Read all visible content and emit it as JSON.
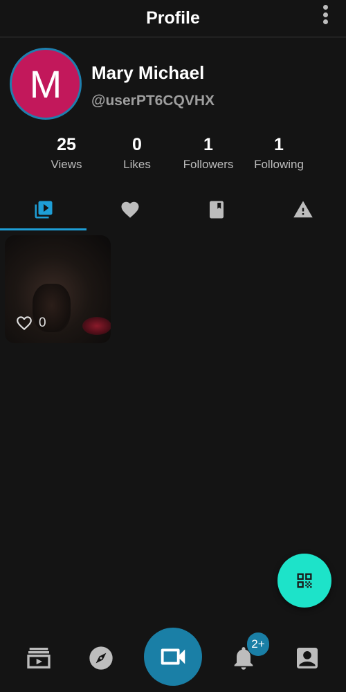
{
  "app_bar": {
    "title": "Profile",
    "more_icon": "more-vert-icon"
  },
  "profile": {
    "avatar_initial": "M",
    "avatar_color": "#c2185b",
    "name": "Mary Michael",
    "handle": "@userPT6CQVHX"
  },
  "stats": [
    {
      "value": "25",
      "label": "Views"
    },
    {
      "value": "0",
      "label": "Likes"
    },
    {
      "value": "1",
      "label": "Followers"
    },
    {
      "value": "1",
      "label": "Following"
    }
  ],
  "tabs": [
    {
      "icon": "video-library-icon",
      "active": true
    },
    {
      "icon": "heart-icon",
      "active": false
    },
    {
      "icon": "bookmark-icon",
      "active": false
    },
    {
      "icon": "warning-icon",
      "active": false
    }
  ],
  "videos": [
    {
      "likes": "0"
    }
  ],
  "fab": {
    "icon": "qr-code-icon",
    "color": "#1de3c9"
  },
  "bottom_nav": {
    "items": [
      "feed-icon",
      "explore-compass-icon",
      "record-video-icon",
      "notifications-bell-icon",
      "profile-icon"
    ],
    "notification_badge": "2+",
    "accent": "#1a7fa6"
  }
}
